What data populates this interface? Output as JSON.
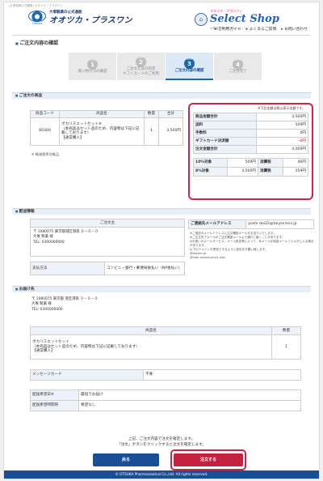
{
  "header": {
    "top_note": "[大塚製薬公式通販] オオツカ・プラスワン",
    "brand_small": "大塚製薬の公式通販",
    "brand_name": "オオツカ・プラスワン",
    "brand_logo_label": "Otsuka",
    "ss_small": "オオツカ・プラスワン",
    "ss_name": "Select Shop",
    "ss_tiny": "大塚製薬のセレクトショップ",
    "nav": [
      "ご利用ガイド",
      "よくあるご質問",
      "お問い合わせ"
    ]
  },
  "page_title": "ご注文内容の確認",
  "steps": [
    {
      "num": "1",
      "label": "買い物カゴの確認",
      "active": false
    },
    {
      "num": "2",
      "label": "ご注文方法の指定\nギフトカードのご利用",
      "active": false
    },
    {
      "num": "3",
      "label": "ご注文内容の確認",
      "active": true
    },
    {
      "num": "4",
      "label": "ご注文完了",
      "active": false
    }
  ],
  "order_section": {
    "title": "ご注文の商品",
    "columns": [
      "商品コード",
      "商品名",
      "数量",
      "合計"
    ],
    "rows": [
      {
        "code": "60360",
        "name": "ポカリスエットセット※\n（本商品はセット品のため、内容物は下記に記載しております）\n【通常購入】",
        "qty": "1",
        "total": "3,500円"
      }
    ],
    "note": "※ 軽減税率対象品"
  },
  "totals": {
    "tax_note": "※下記金額は税込表示金額です。",
    "rows": [
      {
        "label": "商品金額合計",
        "value": "3,500円",
        "red": false
      },
      {
        "label": "送料",
        "value": "509円",
        "red": false
      },
      {
        "label": "手数料",
        "value": "0円",
        "red": false
      },
      {
        "label": "ギフトカード決済額",
        "value": "-0円",
        "red": true
      },
      {
        "label": "注文金額合計",
        "value": "4,009円",
        "red": false
      }
    ],
    "tax_split": [
      {
        "label": "10%対象",
        "amount": "509円",
        "tax_label": "消費税",
        "tax": "46円"
      },
      {
        "label": "8%対象",
        "amount": "3,500円",
        "tax_label": "消費税",
        "tax": "259円"
      }
    ]
  },
  "shipping_section": {
    "title": "配送情報",
    "orderer_header": "ご注文主",
    "orderer_address": "〒 1080075 東京都港区港南 ０－０－０\n大塚 製薬 様\nTEL: 0300000000",
    "payment_label": "支払方法",
    "payment_value": "コンビニ・銀行・郵便局後払い（NP後払い）",
    "email_label": "ご連絡先メールアドレス",
    "email_value": "yoshi-doi22@taiyocross.jp",
    "email_notes": "※ご指定のメールアドレスに注文確認メールをお送りいたします。\n※ご注文完了メールがご注文確認メールより遅れて届くことがあります。\n※お使いのメールサービス、メール設定等によって、本メールが迷惑メールフォルダに入る場合があります。\n以下のドメインを受信できるように設定をお願い致します。\n@otsuka.jp\n@mail-otsuka-plus1.com"
  },
  "destination_section": {
    "title": "お届け先",
    "address": "〒 1080075 東京都 港区港南 ０－０－０\n大塚 製薬 様\nTEL: 0300000000",
    "columns": [
      "商品名",
      "数量"
    ],
    "rows": [
      {
        "name": "ポカリスエットセット\n（本商品はセット品のため、内容物は下記に記載しております）\n【通常購入】",
        "qty": "1"
      }
    ],
    "message_label": "メッセージカード",
    "message_value": "不要",
    "delivery_date_label": "配送希望日※",
    "delivery_date_value": "最短でお届け",
    "delivery_time_label": "配送希望時間帯",
    "delivery_time_value": "希望なし"
  },
  "confirm": {
    "line1": "上記、ご注文内容で注文を確定します。",
    "line2": "「注文」ボタンをクリックすると注文を確定します。",
    "back_label": "戻る",
    "order_label": "注文する"
  },
  "footer": "© OTSUKA Pharmaceutical Co.,Ltd. All rights reserved.",
  "colors": {
    "accent": "#1a67b3",
    "cta": "#c4203f",
    "highlight": "#c8264a"
  }
}
